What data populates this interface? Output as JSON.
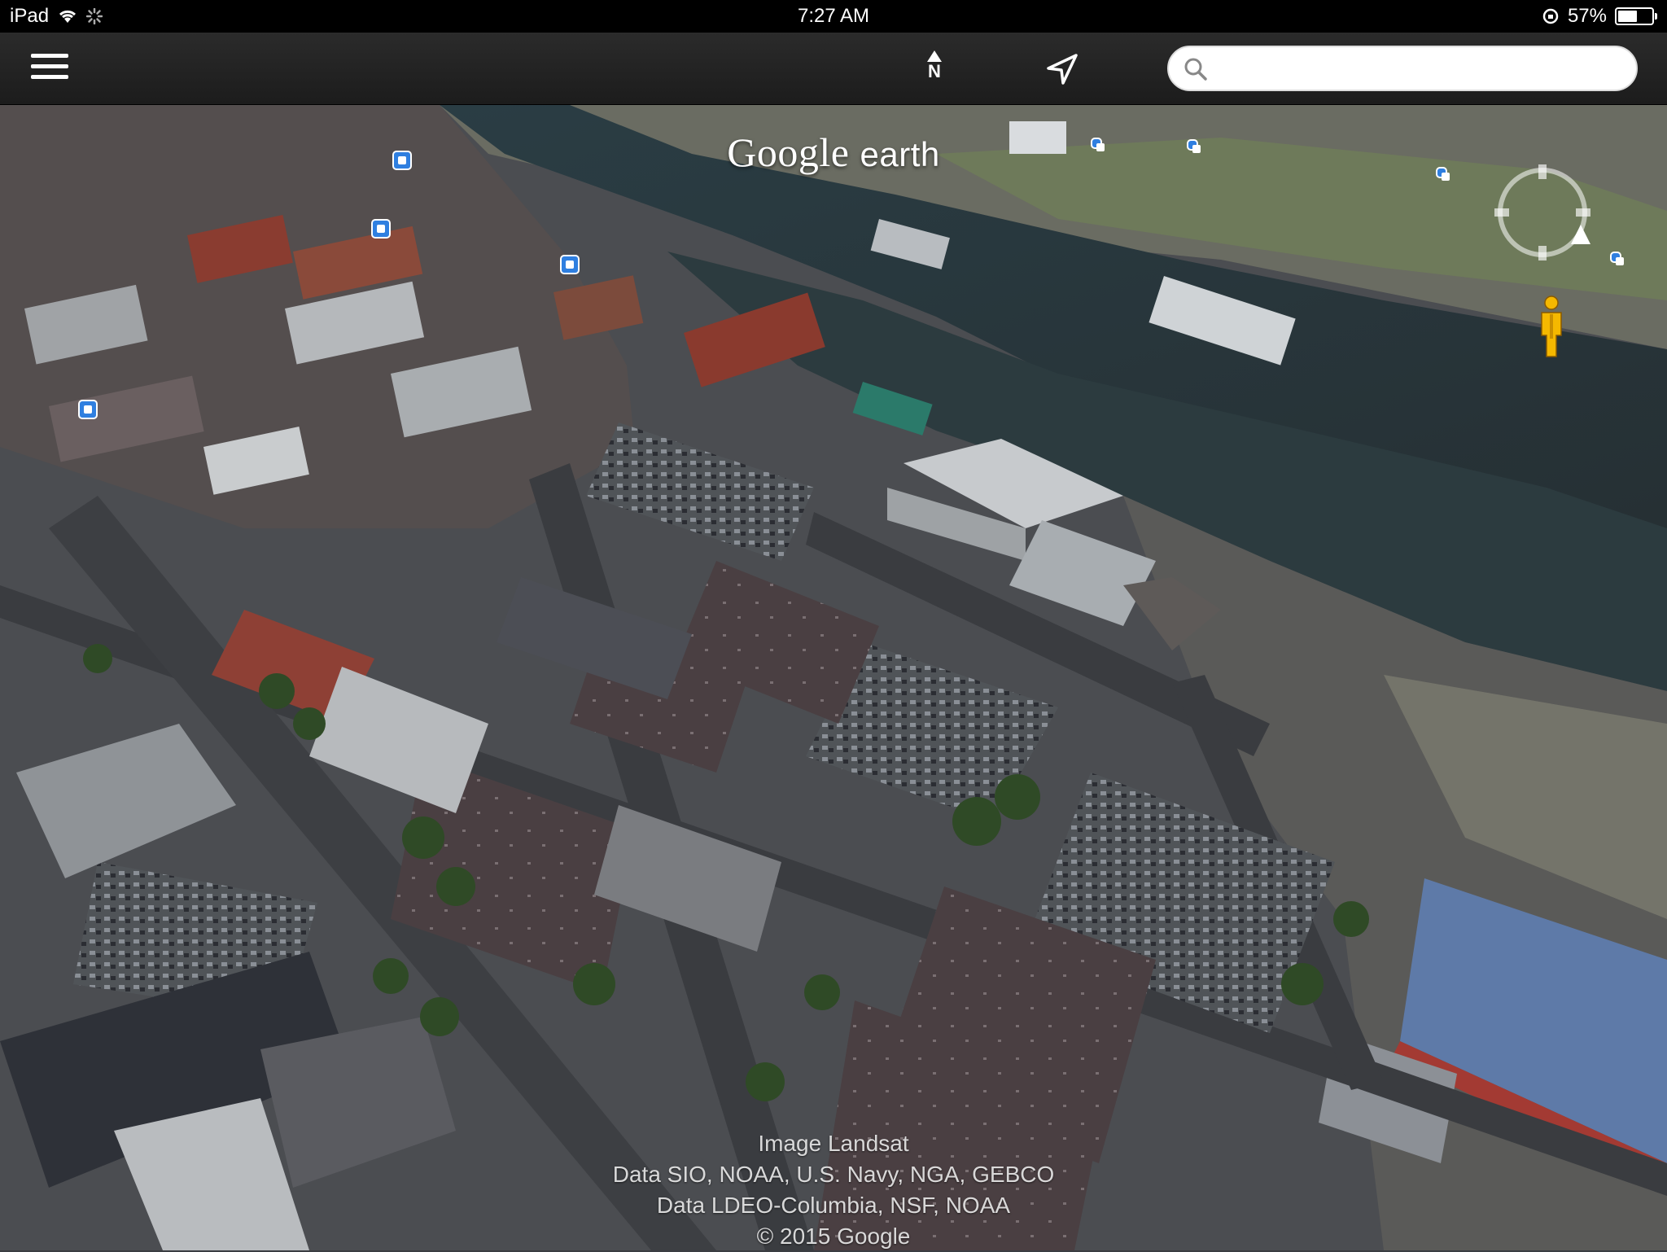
{
  "status_bar": {
    "device": "iPad",
    "time": "7:27 AM",
    "battery_percent_label": "57%",
    "battery_level": 0.57
  },
  "toolbar": {
    "north_label": "N",
    "search": {
      "value": "",
      "placeholder": ""
    }
  },
  "map": {
    "brand_main": "Google",
    "brand_sub": "earth",
    "attribution": [
      "Image Landsat",
      "Data SIO, NOAA, U.S. Navy, NGA, GEBCO",
      "Data LDEO-Columbia, NSF, NOAA",
      "© 2015 Google"
    ]
  },
  "colors": {
    "water": "#2b3b40",
    "toolbar": "#222222",
    "poi_blue": "#2f7fe0",
    "pegman": "#f5b800"
  },
  "icons": [
    "menu-icon",
    "north-arrow-icon",
    "location-arrow-icon",
    "search-icon",
    "compass-icon",
    "pegman-icon",
    "wifi-icon",
    "rotation-lock-icon"
  ]
}
